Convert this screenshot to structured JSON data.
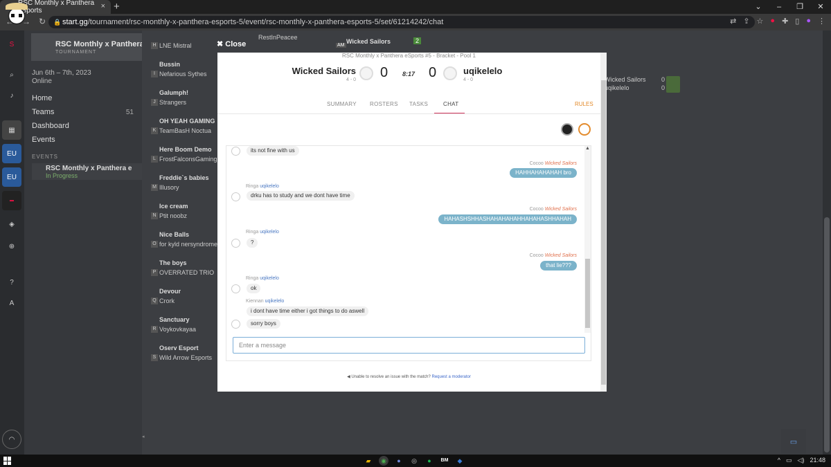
{
  "browser": {
    "tab_title": "RSC Monthly x Panthera eSports",
    "tab_close": "×",
    "new_tab": "+",
    "win_min": "–",
    "win_max": "❐",
    "win_close": "✕",
    "url_host": "start.gg",
    "url_path": "/tournament/rsc-monthly-x-panthera-esports-5/event/rsc-monthly-x-panthera-esports-5/set/61214242/chat"
  },
  "sidebar": {
    "event_name": "RSC Monthly x Panthera eS",
    "event_sub": "TOURNAMENT",
    "date": "Jun 6th – 7th, 2023",
    "location": "Online",
    "menu": [
      {
        "label": "Home"
      },
      {
        "label": "Teams",
        "count": "51"
      },
      {
        "label": "Dashboard"
      },
      {
        "label": "Events"
      }
    ],
    "events_heading": "EVENTS",
    "current_event": "RSC Monthly x Panthera e",
    "current_status": "In Progress"
  },
  "bracket": {
    "rows": [
      {
        "seed": "H",
        "a": "",
        "b": "LNE Mistral"
      },
      {
        "seed": "I",
        "a": "Bussin",
        "b": "Nefarious Sythes"
      },
      {
        "seed": "J",
        "a": "Galumph!",
        "b": "Strangers"
      },
      {
        "seed": "K",
        "a": "OH YEAH GAMING",
        "b": "TeamBasH Noctua"
      },
      {
        "seed": "L",
        "a": "Here Boom Demo",
        "b": "FrostFalconsGaming"
      },
      {
        "seed": "M",
        "a": "Freddie`s babies",
        "b": "Illusory"
      },
      {
        "seed": "N",
        "a": "Ice cream",
        "b": "Ptit noobz"
      },
      {
        "seed": "O",
        "a": "Nice Balls",
        "b": "for kyld nersyndrome"
      },
      {
        "seed": "P",
        "a": "The boys",
        "b": "OVERRATED TRIO"
      },
      {
        "seed": "Q",
        "a": "Devour",
        "b": "Crork"
      },
      {
        "seed": "R",
        "a": "Sanctuary",
        "b": "Voykovkayaa"
      },
      {
        "seed": "S",
        "a": "Oserv Esport",
        "b": "Wild Arrow Esports"
      }
    ],
    "middle_top": "RestInPeacee",
    "middle_match": "Wicked Sailors",
    "middle_badge": "AM",
    "middle_score": "2",
    "right_a": "Wicked Sailors",
    "right_b": "uqikelelo",
    "right_score_a": "0",
    "right_score_b": "0"
  },
  "modal": {
    "close_label": "Close",
    "bracket_title": "RSC Monthly x Panthera eSports #5 - Bracket - Pool 1",
    "team_left": "Wicked Sailors",
    "team_left_record": "4 - 0",
    "team_right": "uqikelelo",
    "team_right_record": "4 - 0",
    "score_left": "0",
    "score_right": "0",
    "timer": "8:17",
    "tabs": [
      "SUMMARY",
      "ROSTERS",
      "TASKS",
      "CHAT"
    ],
    "rules": "RULES",
    "messages": [
      {
        "side": "in",
        "text": "its not fine with us"
      },
      {
        "side": "out",
        "sender": "Cocoo",
        "team": "Wicked Sailors",
        "text": "HAHHAHAHAHAH bro"
      },
      {
        "side": "in",
        "sender": "Ringa",
        "team": "uqikelelo",
        "text": "drku has to study and we dont have time"
      },
      {
        "side": "out",
        "sender": "Cocoo",
        "team": "Wicked Sailors",
        "text": "HAHASHSHHASHAHAHAHAHHAHAHASHHAHAH"
      },
      {
        "side": "in",
        "sender": "Ringa",
        "team": "uqikelelo",
        "text": "?"
      },
      {
        "side": "out",
        "sender": "Cocoo",
        "team": "Wicked Sailors",
        "text": "that lie???"
      },
      {
        "side": "in",
        "sender": "Ringa",
        "team": "uqikelelo",
        "text": "ok"
      },
      {
        "side": "in",
        "sender": "Kiennan",
        "team": "uqikelelo",
        "text": "i dont have time either i got things to do aswell"
      },
      {
        "side": "in",
        "text": "sorry boys"
      }
    ],
    "input_placeholder": "Enter a message",
    "footer_text": "Unable to resolve an issue with the match?",
    "footer_link": "Request a moderator"
  },
  "taskbar": {
    "time": "21:48",
    "app_label": "BM"
  },
  "colors": {
    "accent_tab": "#d0345a",
    "rules": "#e38b2c",
    "out_bubble": "#7bb3ca",
    "in_team": "#4a78c2",
    "out_team": "#e0704c"
  }
}
